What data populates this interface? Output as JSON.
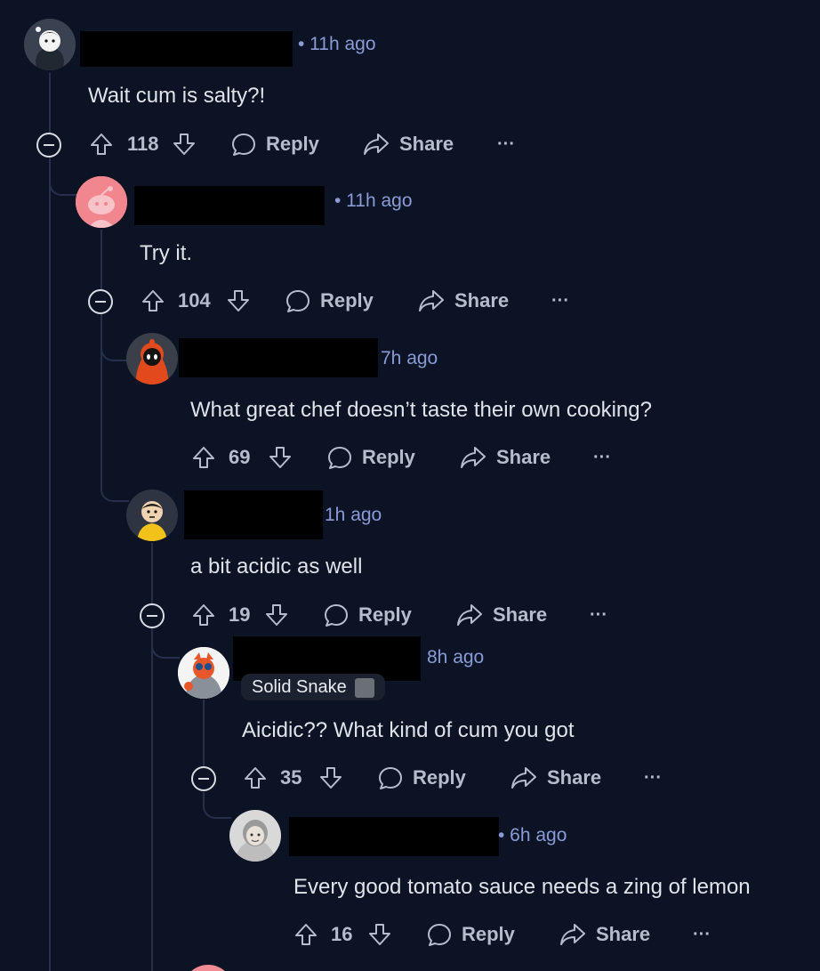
{
  "comments": [
    {
      "time": "• 11h ago",
      "body": "Wait cum is salty?!",
      "votes": "118",
      "reply_label": "Reply",
      "share_label": "Share",
      "more_label": "···"
    },
    {
      "time": "• 11h ago",
      "body": "Try it.",
      "votes": "104",
      "reply_label": "Reply",
      "share_label": "Share",
      "more_label": "···"
    },
    {
      "time": "7h ago",
      "body": "What great chef doesn’t taste their own cooking?",
      "votes": "69",
      "reply_label": "Reply",
      "share_label": "Share",
      "more_label": "···"
    },
    {
      "time": "1h ago",
      "body": "a bit acidic as well",
      "votes": "19",
      "reply_label": "Reply",
      "share_label": "Share",
      "more_label": "···"
    },
    {
      "time": "8h ago",
      "flair": "Solid Snake",
      "body": "Aicidic?? What kind of cum you got",
      "votes": "35",
      "reply_label": "Reply",
      "share_label": "Share",
      "more_label": "···"
    },
    {
      "time": "• 6h ago",
      "body": "Every good tomato sauce needs a zing of lemon",
      "votes": "16",
      "reply_label": "Reply",
      "share_label": "Share",
      "more_label": "···"
    }
  ],
  "colors": {
    "background": "#0b1324",
    "thread_line": "#26304a",
    "timestamp": "#8a9bd6",
    "text": "#dfe3ea",
    "action": "#b5bdcc"
  },
  "icons": [
    "upvote-icon",
    "downvote-icon",
    "comment-bubble-icon",
    "share-arrow-icon",
    "more-icon",
    "collapse-icon"
  ]
}
